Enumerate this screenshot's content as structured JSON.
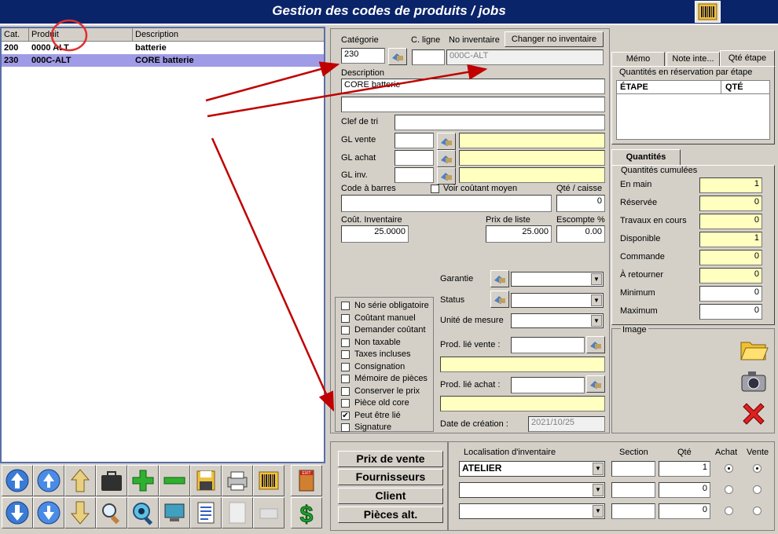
{
  "window": {
    "title": "Gestion des codes de produits / jobs"
  },
  "list": {
    "headers": {
      "cat": "Cat.",
      "product": "Produit",
      "description": "Description"
    },
    "rows": [
      {
        "cat": "200",
        "product": "0000 ALT",
        "description": "batterie"
      },
      {
        "cat": "230",
        "product": "000C-ALT",
        "description": "CORE batterie"
      }
    ]
  },
  "form": {
    "categorie_label": "Catégorie",
    "categorie_value": "230",
    "c_ligne_label": "C. ligne",
    "no_inventaire_label": "No inventaire",
    "no_inventaire_value": "000C-ALT",
    "changer_button": "Changer no inventaire",
    "description_label": "Description",
    "description_value": "CORE batterie",
    "description2_value": "",
    "clef_label": "Clef de tri",
    "gl_vente_label": "GL vente",
    "gl_achat_label": "GL achat",
    "gl_inv_label": "GL inv.",
    "code_barres_label": "Code à barres",
    "voir_cout_label": "Voir coûtant moyen",
    "qte_caisse_label": "Qté / caisse",
    "qte_caisse_value": "0",
    "cout_inv_label": "Coût. Inventaire",
    "cout_inv_value": "25.0000",
    "prix_liste_label": "Prix de liste",
    "prix_liste_value": "25.000",
    "escompte_label": "Escompte %",
    "escompte_value": "0.00",
    "garantie_label": "Garantie",
    "status_label": "Status",
    "unite_label": "Unité de mesure",
    "prod_lie_vente_label": "Prod. lié vente :",
    "prod_lie_achat_label": "Prod. lié achat :",
    "date_creation_label": "Date de création :",
    "date_creation_value": "2021/10/25"
  },
  "options": [
    {
      "label": "No série obligatoire",
      "checked": false
    },
    {
      "label": "Coûtant manuel",
      "checked": false
    },
    {
      "label": "Demander coûtant",
      "checked": false
    },
    {
      "label": "Non taxable",
      "checked": false
    },
    {
      "label": "Taxes incluses",
      "checked": false
    },
    {
      "label": "Consignation",
      "checked": false
    },
    {
      "label": "Mémoire de pièces",
      "checked": false
    },
    {
      "label": "Conserver le prix",
      "checked": false
    },
    {
      "label": "Pièce old core",
      "checked": false
    },
    {
      "label": "Peut être lié",
      "checked": true
    },
    {
      "label": "Signature",
      "checked": false
    }
  ],
  "right_tabs": {
    "memo": "Mémo",
    "note": "Note inte...",
    "qte_etape": "Qté étape"
  },
  "reservation": {
    "title": "Quantités en réservation par étape",
    "col_etape": "ÉTAPE",
    "col_qte": "QTÉ"
  },
  "quantites": {
    "tab": "Quantités",
    "group": "Quantités cumulées",
    "rows": [
      {
        "label": "En main",
        "value": "1"
      },
      {
        "label": "Réservée",
        "value": "0"
      },
      {
        "label": "Travaux en cours",
        "value": "0"
      },
      {
        "label": "Disponible",
        "value": "1"
      },
      {
        "label": "Commande",
        "value": "0"
      },
      {
        "label": "À retourner",
        "value": "0"
      },
      {
        "label": "Minimum",
        "value": "0"
      },
      {
        "label": "Maximum",
        "value": "0"
      }
    ]
  },
  "image": {
    "label": "Image"
  },
  "bottom_buttons": {
    "prix_vente": "Prix de vente",
    "fournisseurs": "Fournisseurs",
    "client": "Client",
    "pieces_alt": "Pièces alt."
  },
  "localisation": {
    "headers": {
      "loc": "Localisation d'inventaire",
      "section": "Section",
      "qte": "Qté",
      "achat": "Achat",
      "vente": "Vente"
    },
    "rows": [
      {
        "loc": "ATELIER",
        "section": "",
        "qte": "1",
        "achat": true,
        "vente": true
      },
      {
        "loc": "",
        "section": "",
        "qte": "0",
        "achat": false,
        "vente": false
      },
      {
        "loc": "",
        "section": "",
        "qte": "0",
        "achat": false,
        "vente": false
      }
    ]
  },
  "toolbar_icons": [
    "first-record-icon",
    "previous-record-icon",
    "up-arrow-icon",
    "briefcase-icon",
    "add-icon",
    "remove-icon",
    "save-disk-icon",
    "print-icon",
    "barcode-icon",
    "exit-door-icon",
    "last-record-icon",
    "next-record-icon",
    "down-arrow-icon",
    "search-magnifier-icon",
    "search-eye-icon",
    "monitor-icon",
    "report-list-icon",
    "blank-page-icon",
    "disabled-tool-icon",
    "dollar-icon"
  ],
  "colors": {
    "title_bar": "#0a246a",
    "selection": "#a09be6",
    "field_yellow": "#ffffc0",
    "arrow_red": "#c00000"
  }
}
